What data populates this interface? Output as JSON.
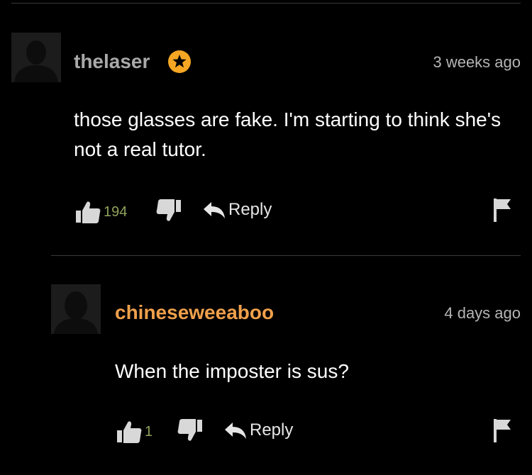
{
  "comments": [
    {
      "username": "thelaser",
      "username_color": "#a9a9a9",
      "badge": "star-badge-icon",
      "badge_color": "#f5a623",
      "timestamp": "3 weeks ago",
      "text": "those glasses are fake. I'm starting to think she's not a real tutor.",
      "likes": "194",
      "likes_color": "#8fa35a",
      "reply_label": "Reply"
    },
    {
      "username": "chineseweeaboo",
      "username_color": "#f0a04b",
      "timestamp": "4 days ago",
      "text": "When the imposter is sus?",
      "likes": "1",
      "likes_color": "#8fa35a",
      "reply_label": "Reply"
    }
  ]
}
